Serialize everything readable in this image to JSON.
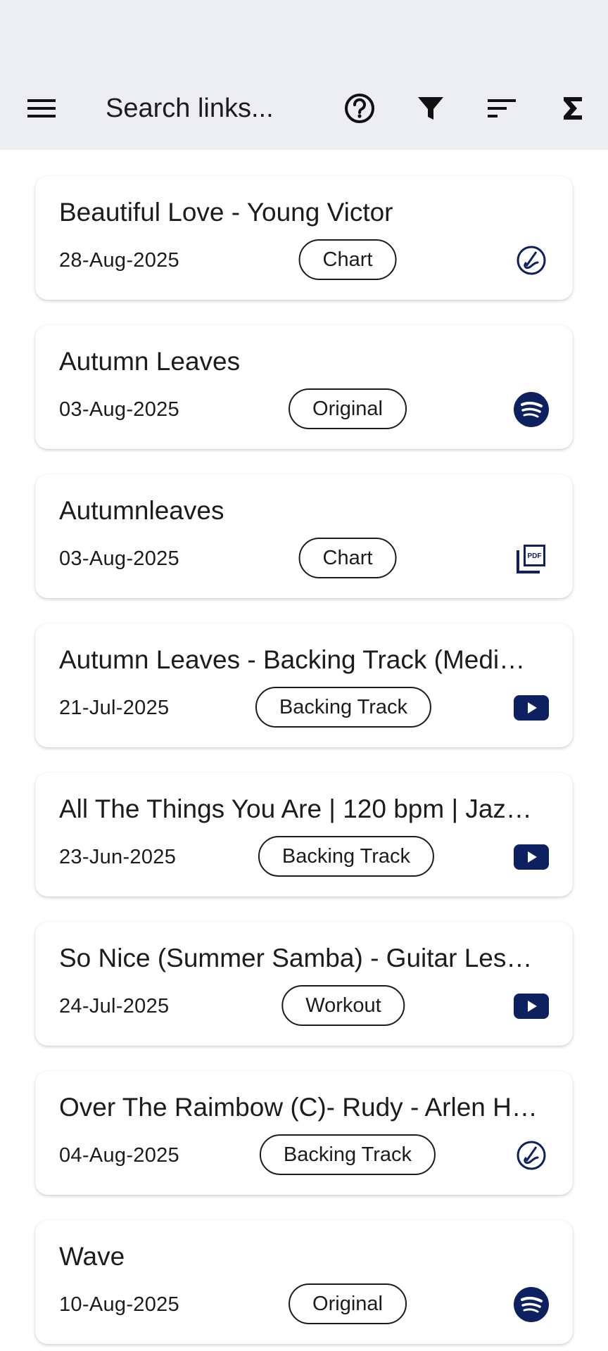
{
  "toolbar": {
    "menu_icon": "menu-icon",
    "search_placeholder": "Search links...",
    "help_icon": "help-circle-icon",
    "filter_icon": "filter-icon",
    "sort_icon": "sort-icon",
    "sum_icon": "sigma-icon"
  },
  "colors": {
    "toolbar_bg": "#eceef2",
    "icon_navy": "#0d2060",
    "text": "#1c1c1c"
  },
  "links": [
    {
      "title": "Beautiful Love - Young Victor",
      "date": "28-Aug-2025",
      "tag": "Chart",
      "icon": "musescore-icon"
    },
    {
      "title": "Autumn Leaves",
      "date": "03-Aug-2025",
      "tag": "Original",
      "icon": "spotify-icon"
    },
    {
      "title": "Autumnleaves",
      "date": "03-Aug-2025",
      "tag": "Chart",
      "icon": "pdf-icon"
    },
    {
      "title": "Autumn Leaves - Backing Track (Medi…",
      "date": "21-Jul-2025",
      "tag": "Backing Track",
      "icon": "youtube-icon"
    },
    {
      "title": "All The Things You Are | 120 bpm | Jaz…",
      "date": "23-Jun-2025",
      "tag": "Backing Track",
      "icon": "youtube-icon"
    },
    {
      "title": "So Nice (Summer Samba) - Guitar Les…",
      "date": "24-Jul-2025",
      "tag": "Workout",
      "icon": "youtube-icon"
    },
    {
      "title": "Over The Raimbow (C)- Rudy - Arlen H…",
      "date": "04-Aug-2025",
      "tag": "Backing Track",
      "icon": "musescore-icon"
    },
    {
      "title": "Wave",
      "date": "10-Aug-2025",
      "tag": "Original",
      "icon": "spotify-icon"
    }
  ]
}
